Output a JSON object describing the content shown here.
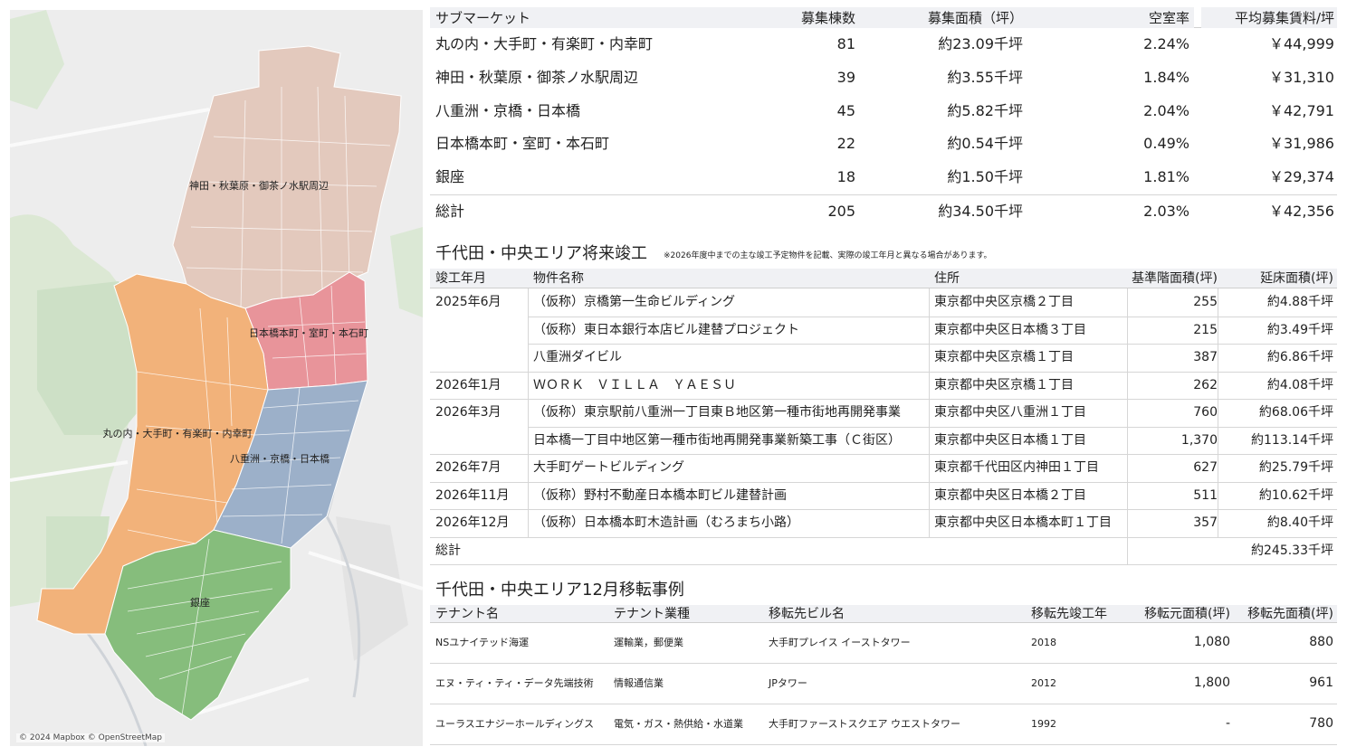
{
  "map": {
    "attribution": "© 2024 Mapbox © OpenStreetMap",
    "areas": [
      {
        "label": "神田・秋葉原・御茶ノ水駅周辺",
        "color": "#e3c9bd"
      },
      {
        "label": "日本橋本町・室町・本石町",
        "color": "#e8949a"
      },
      {
        "label": "丸の内・大手町・有楽町・内幸町",
        "color": "#f2b27a"
      },
      {
        "label": "八重洲・京橋・日本橋",
        "color": "#9cb0c9"
      },
      {
        "label": "銀座",
        "color": "#86bd7c"
      }
    ]
  },
  "submarket": {
    "headers": [
      "サブマーケット",
      "募集棟数",
      "募集面積（坪）",
      "空室率",
      "平均募集賃料/坪"
    ],
    "rows": [
      [
        "丸の内・大手町・有楽町・内幸町",
        "81",
        "約23.09千坪",
        "2.24%",
        "￥44,999"
      ],
      [
        "神田・秋葉原・御茶ノ水駅周辺",
        "39",
        "約3.55千坪",
        "1.84%",
        "￥31,310"
      ],
      [
        "八重洲・京橋・日本橋",
        "45",
        "約5.82千坪",
        "2.04%",
        "￥42,791"
      ],
      [
        "日本橋本町・室町・本石町",
        "22",
        "約0.54千坪",
        "0.49%",
        "￥31,986"
      ],
      [
        "銀座",
        "18",
        "約1.50千坪",
        "1.81%",
        "￥29,374"
      ],
      [
        "総計",
        "205",
        "約34.50千坪",
        "2.03%",
        "￥42,356"
      ]
    ]
  },
  "future": {
    "title": "千代田・中央エリア将来竣工",
    "note": "※2026年度中までの主な竣工予定物件を記載、実際の竣工年月と異なる場合があります。",
    "headers": [
      "竣工年月",
      "物件名称",
      "住所",
      "基準階面積(坪)",
      "延床面積(坪)"
    ],
    "rows": [
      [
        "2025年6月",
        "（仮称）京橋第一生命ビルディング",
        "東京都中央区京橋２丁目",
        "255",
        "約4.88千坪"
      ],
      [
        "",
        "（仮称）東日本銀行本店ビル建替プロジェクト",
        "東京都中央区日本橋３丁目",
        "215",
        "約3.49千坪"
      ],
      [
        "",
        "八重洲ダイビル",
        "東京都中央区京橋１丁目",
        "387",
        "約6.86千坪"
      ],
      [
        "2026年1月",
        "ＷＯＲＫ　ＶＩＬＬＡ　ＹＡＥＳＵ",
        "東京都中央区京橋１丁目",
        "262",
        "約4.08千坪"
      ],
      [
        "2026年3月",
        "（仮称）東京駅前八重洲一丁目東Ｂ地区第一種市街地再開発事業",
        "東京都中央区八重洲１丁目",
        "760",
        "約68.06千坪"
      ],
      [
        "",
        "日本橋一丁目中地区第一種市街地再開発事業新築工事（Ｃ街区）",
        "東京都中央区日本橋１丁目",
        "1,370",
        "約113.14千坪"
      ],
      [
        "2026年7月",
        "大手町ゲートビルディング",
        "東京都千代田区内神田１丁目",
        "627",
        "約25.79千坪"
      ],
      [
        "2026年11月",
        "（仮称）野村不動産日本橋本町ビル建替計画",
        "東京都中央区日本橋２丁目",
        "511",
        "約10.62千坪"
      ],
      [
        "2026年12月",
        "（仮称）日本橋本町木造計画（むろまち小路）",
        "東京都中央区日本橋本町１丁目",
        "357",
        "約8.40千坪"
      ],
      [
        "総計",
        "",
        "",
        "",
        "約245.33千坪"
      ]
    ]
  },
  "relocation": {
    "title": "千代田・中央エリア12月移転事例",
    "headers": [
      "テナント名",
      "テナント業種",
      "移転先ビル名",
      "移転先竣工年",
      "移転元面積(坪)",
      "移転先面積(坪)"
    ],
    "rows": [
      [
        "NSユナイテッド海運",
        "運輸業，郵便業",
        "大手町プレイス イーストタワー",
        "2018",
        "1,080",
        "880"
      ],
      [
        "エヌ・ティ・ティ・データ先端技術",
        "情報通信業",
        "JPタワー",
        "2012",
        "1,800",
        "961"
      ],
      [
        "ユーラスエナジーホールディングス",
        "電気・ガス・熱供給・水道業",
        "大手町ファーストスクエア ウエストタワー",
        "1992",
        "-",
        "780"
      ]
    ]
  }
}
